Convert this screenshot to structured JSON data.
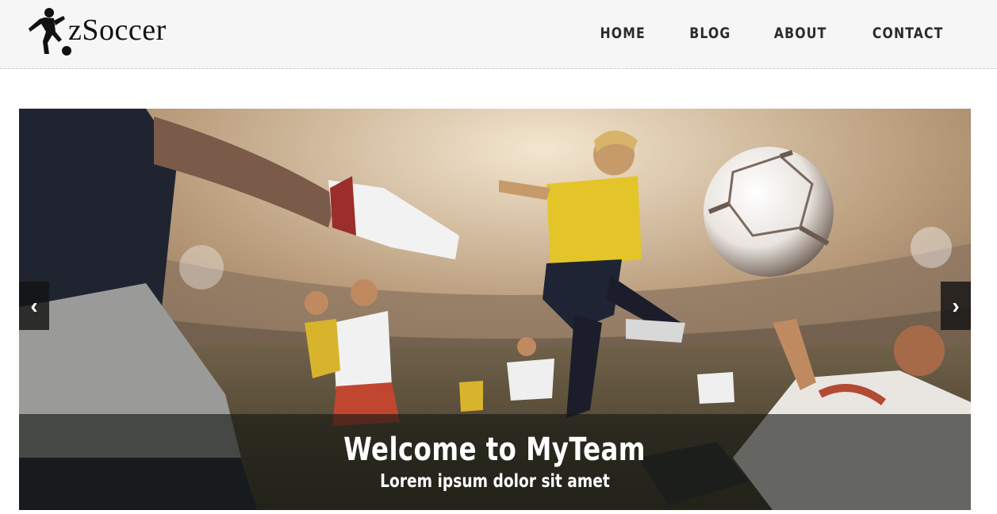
{
  "header": {
    "logo_text": "zSoccer",
    "nav": [
      "HOME",
      "BLOG",
      "ABOUT",
      "CONTACT"
    ]
  },
  "slider": {
    "caption_title": "Welcome to MyTeam",
    "caption_subtitle": "Lorem ipsum dolor sit amet",
    "prev_icon": "‹",
    "next_icon": "›"
  }
}
